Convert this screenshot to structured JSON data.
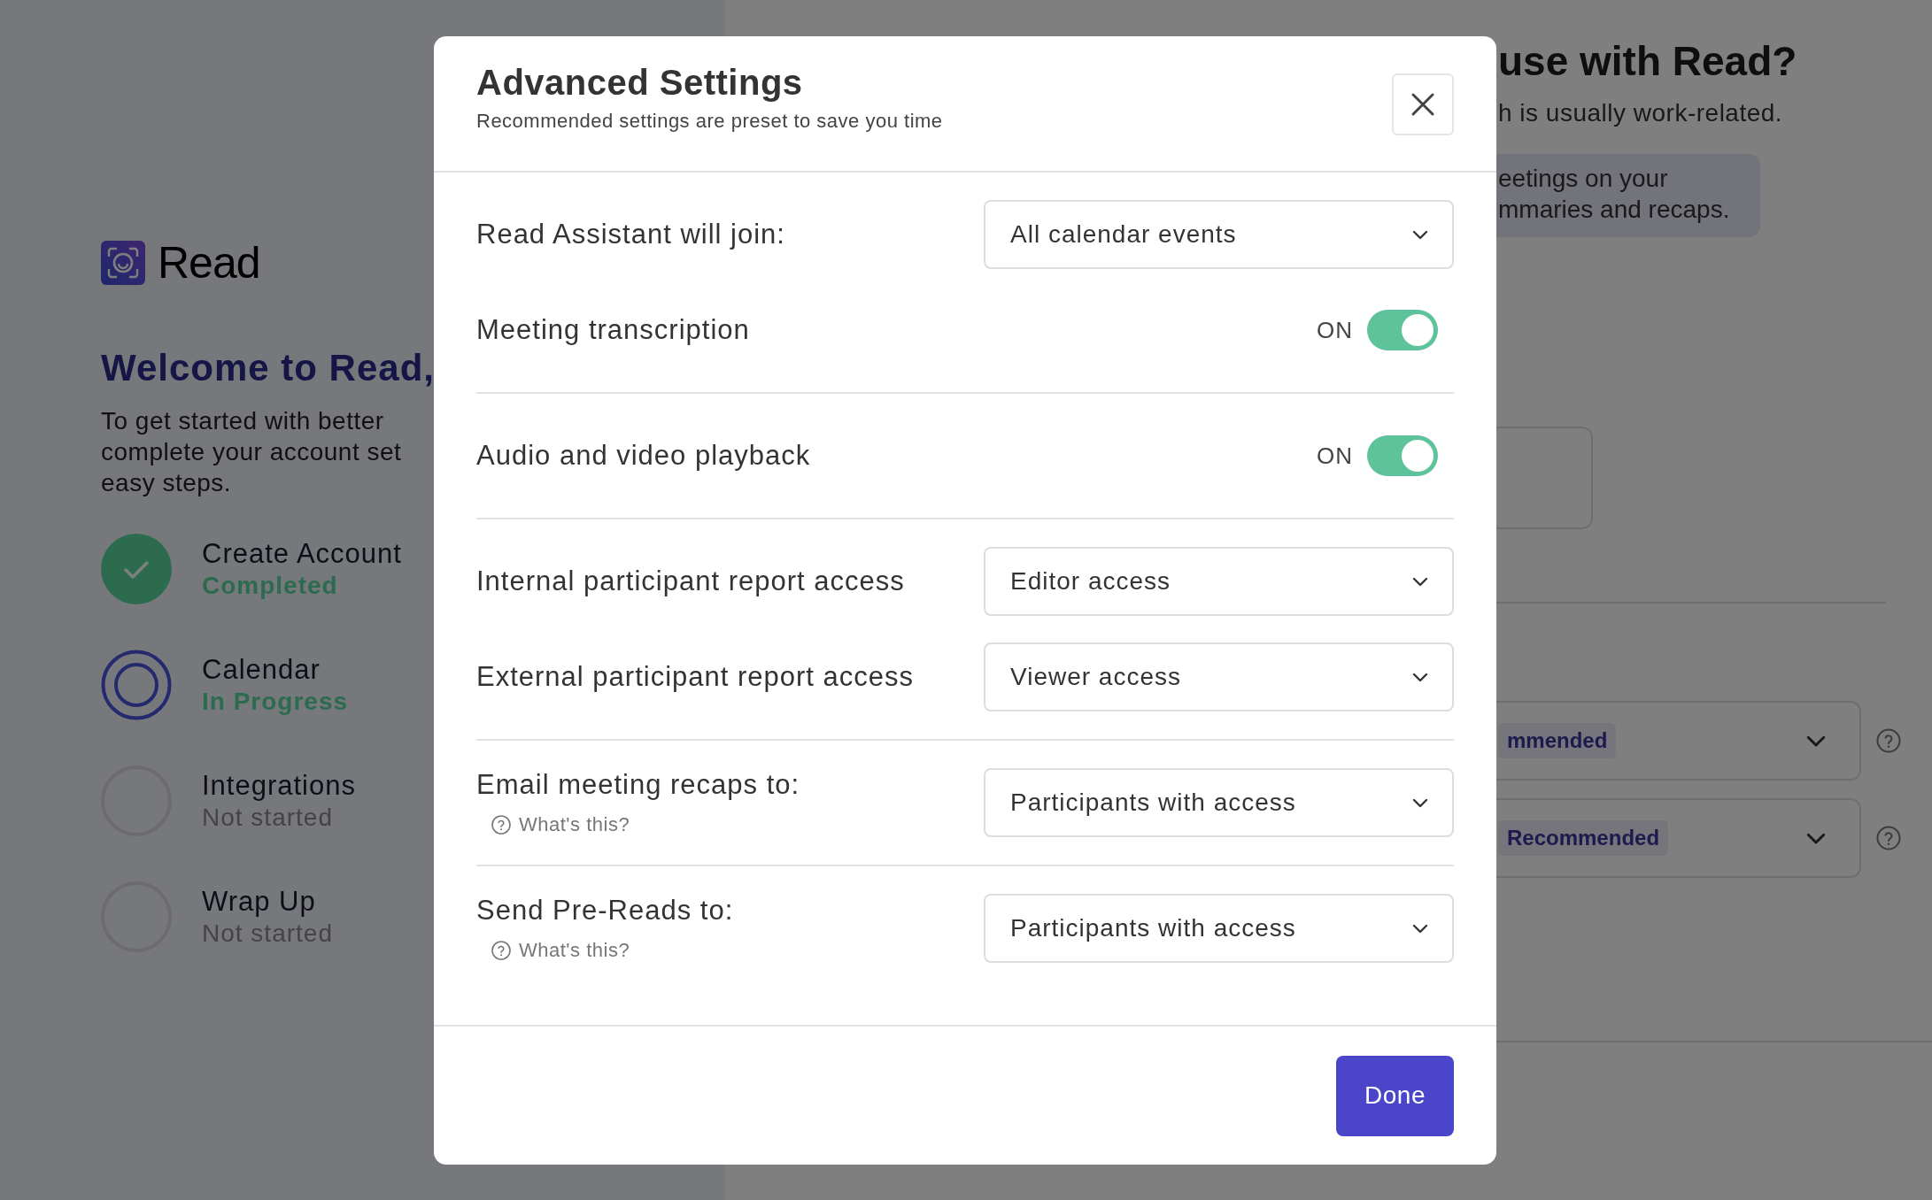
{
  "brand": {
    "name": "Read"
  },
  "welcome": {
    "title": "Welcome to Read,",
    "lines": [
      "To get started with better",
      "complete your account set",
      "easy steps."
    ]
  },
  "steps": [
    {
      "title": "Create Account",
      "status": "Completed",
      "kind": "completed"
    },
    {
      "title": "Calendar",
      "status": "In Progress",
      "kind": "current"
    },
    {
      "title": "Integrations",
      "status": "Not started",
      "kind": "pending"
    },
    {
      "title": "Wrap Up",
      "status": "Not started",
      "kind": "pending"
    }
  ],
  "background": {
    "title": "use with Read?",
    "subtitle": "h is usually work-related.",
    "note_lines": [
      "eetings on your",
      "mmaries and recaps."
    ],
    "selects": [
      {
        "tag": "mmended"
      },
      {
        "tag": "Recommended"
      }
    ]
  },
  "modal": {
    "title": "Advanced Settings",
    "subtitle": "Recommended settings are preset to save you time",
    "sections": [
      [
        {
          "kind": "select",
          "label": "Read Assistant will join:",
          "value": "All calendar events"
        },
        {
          "kind": "toggle",
          "label": "Meeting transcription",
          "state_label": "ON",
          "on": true
        }
      ],
      [
        {
          "kind": "toggle",
          "label": "Audio and video playback",
          "state_label": "ON",
          "on": true
        }
      ],
      [
        {
          "kind": "select",
          "label": "Internal participant report access",
          "value": "Editor access"
        },
        {
          "kind": "select",
          "label": "External participant report access",
          "value": "Viewer access"
        }
      ],
      [
        {
          "kind": "select",
          "label": "Email meeting recaps to:",
          "value": "Participants with access",
          "help": "What's this?"
        }
      ],
      [
        {
          "kind": "select",
          "label": "Send Pre-Reads to:",
          "value": "Participants with access",
          "help": "What's this?"
        }
      ]
    ],
    "done": "Done"
  }
}
